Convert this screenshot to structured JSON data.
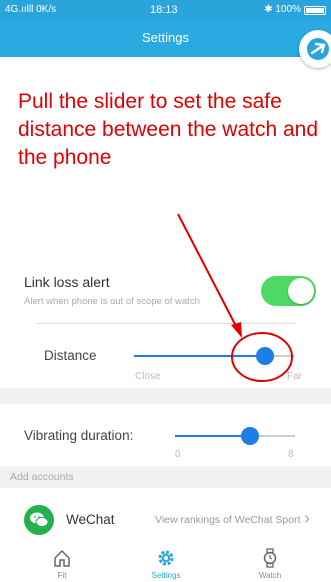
{
  "status_bar": {
    "left": "4G.ıılll 0K/s",
    "time": "18:13",
    "right": "✱ 100%"
  },
  "header": {
    "title": "Settings"
  },
  "annotation": {
    "text": "Pull the slider to set the safe distance between the watch and the phone"
  },
  "link_loss": {
    "label": "Link loss alert",
    "description": "Alert when phone is out of scope of watch",
    "enabled": true
  },
  "distance": {
    "label": "Distance",
    "min_label": "Close",
    "max_label": "Far",
    "value_fraction": 0.82
  },
  "vibrating": {
    "label": "Vibrating duration:",
    "min": "0",
    "max": "8",
    "value": 5
  },
  "accounts": {
    "header": "Add accounts",
    "items": [
      {
        "name": "WeChat",
        "link": "View rankings of WeChat Sport"
      }
    ]
  },
  "tabs": [
    {
      "label": "Fit",
      "icon": "home-icon",
      "active": false
    },
    {
      "label": "Settings",
      "icon": "gear-icon",
      "active": true
    },
    {
      "label": "Watch",
      "icon": "watch-icon",
      "active": false
    }
  ],
  "colors": {
    "header": "#29abe2",
    "accent": "#1e7ee6",
    "toggle_on": "#4cd964",
    "annotation": "#e00000",
    "wechat": "#22b14c"
  }
}
